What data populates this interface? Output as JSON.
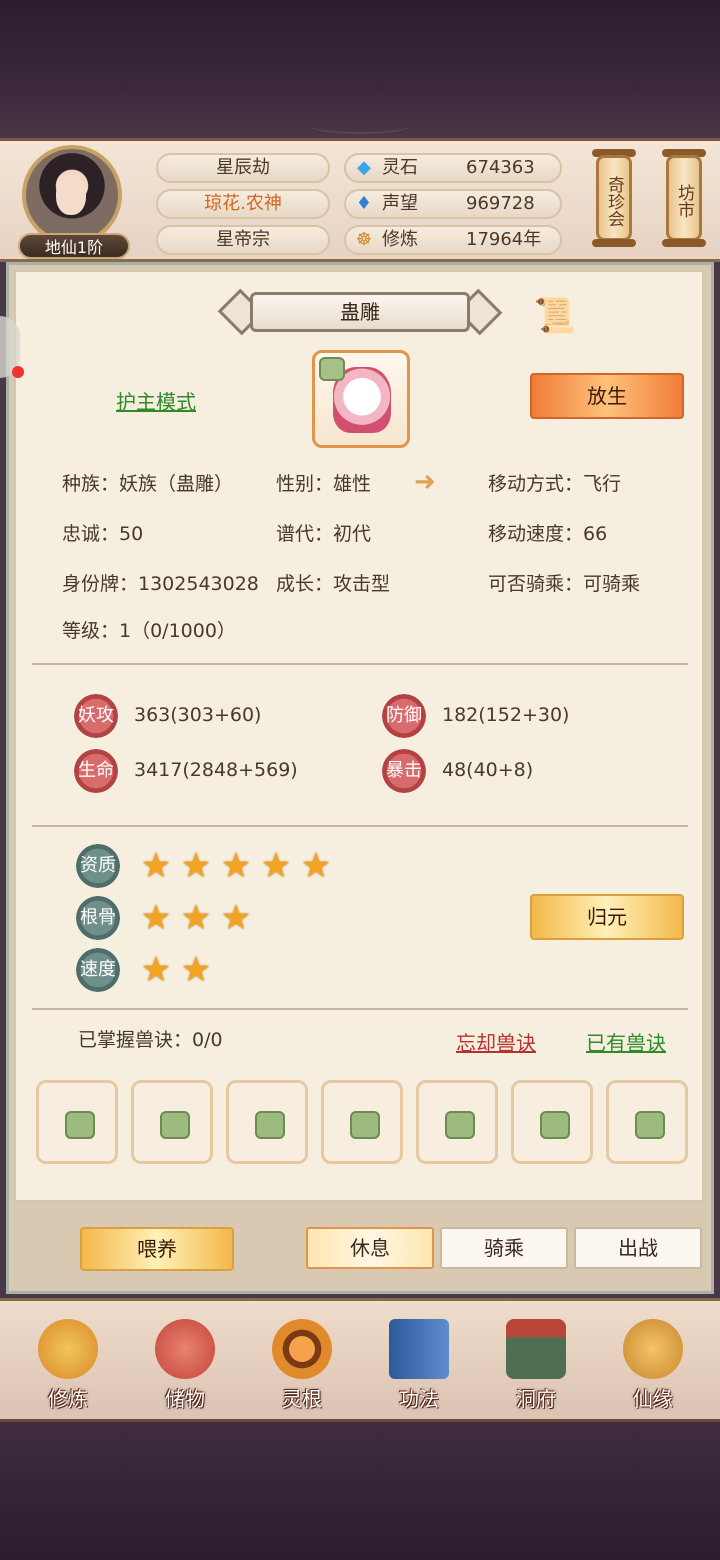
{
  "header": {
    "rank": "地仙1阶",
    "name": "星辰劫",
    "title": "琼花.农神",
    "sect": "星帝宗",
    "resources": [
      {
        "icon": "spirit-stone-icon",
        "label": "灵石",
        "value": "674363"
      },
      {
        "icon": "reputation-icon",
        "label": "声望",
        "value": "969728"
      },
      {
        "icon": "cultivation-icon",
        "label": "修炼",
        "value": "17964年"
      }
    ],
    "shop_buttons": [
      "奇珍会",
      "坊市"
    ]
  },
  "pet": {
    "name": "蛊雕",
    "mode_link": "护主模式",
    "release_button": "放生",
    "attributes": {
      "race": "种族：妖族（蛊雕）",
      "gender": "性别：雄性",
      "move_type": "移动方式：飞行",
      "loyalty": "忠诚：50",
      "generation": "谱代：初代",
      "move_speed": "移动速度：66",
      "id_tag": "身份牌：1302543028",
      "growth": "成长：攻击型",
      "rideable": "可否骑乘：可骑乘",
      "level": "等级：1（0/1000）"
    },
    "stats": [
      {
        "label": "妖攻",
        "value": "363(303+60)"
      },
      {
        "label": "防御",
        "value": "182(152+30)"
      },
      {
        "label": "生命",
        "value": "3417(2848+569)"
      },
      {
        "label": "暴击",
        "value": "48(40+8)"
      }
    ],
    "aptitudes": [
      {
        "label": "资质",
        "stars": 5
      },
      {
        "label": "根骨",
        "stars": 3
      },
      {
        "label": "速度",
        "stars": 2
      }
    ],
    "return_button": "归元",
    "skills": {
      "mastered": "已掌握兽诀：0/0",
      "forget_link": "忘却兽诀",
      "owned_link": "已有兽诀",
      "slots": 7
    }
  },
  "actions": {
    "feed": "喂养",
    "rest": "休息",
    "ride": "骑乘",
    "battle": "出战",
    "active": "rest"
  },
  "nav": [
    {
      "label": "修炼",
      "icon": "monk-icon",
      "color": "#d98a2a"
    },
    {
      "label": "储物",
      "icon": "bag-icon",
      "color": "#c2453b"
    },
    {
      "label": "灵根",
      "icon": "spirit-root-icon",
      "color": "#b8641e"
    },
    {
      "label": "功法",
      "icon": "book-icon",
      "color": "#3f6fb0"
    },
    {
      "label": "洞府",
      "icon": "cave-house-icon",
      "color": "#6a8a5a"
    },
    {
      "label": "仙缘",
      "icon": "gourd-icon",
      "color": "#c9872c"
    }
  ]
}
